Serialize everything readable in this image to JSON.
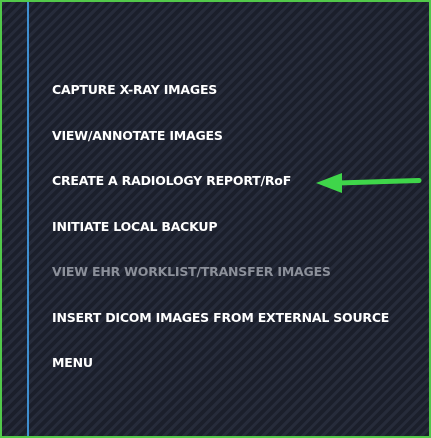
{
  "menu": {
    "items": [
      {
        "label": "CAPTURE X-RAY IMAGES",
        "enabled": true
      },
      {
        "label": "VIEW/ANNOTATE IMAGES",
        "enabled": true
      },
      {
        "label": "CREATE A RADIOLOGY REPORT/RoF",
        "enabled": true
      },
      {
        "label": "INITIATE LOCAL BACKUP",
        "enabled": true
      },
      {
        "label": "VIEW EHR WORKLIST/TRANSFER IMAGES",
        "enabled": false
      },
      {
        "label": "INSERT DICOM IMAGES FROM EXTERNAL SOURCE",
        "enabled": true
      },
      {
        "label": "MENU",
        "enabled": true
      }
    ]
  },
  "annotation": {
    "arrow_target": "CREATE A RADIOLOGY REPORT/RoF",
    "arrow_color": "#3fd64a"
  },
  "colors": {
    "border": "#52c94a",
    "background": "#1f2330",
    "divider_line": "#3f8fd0",
    "text": "#ffffff",
    "text_disabled": "#8c909a"
  }
}
